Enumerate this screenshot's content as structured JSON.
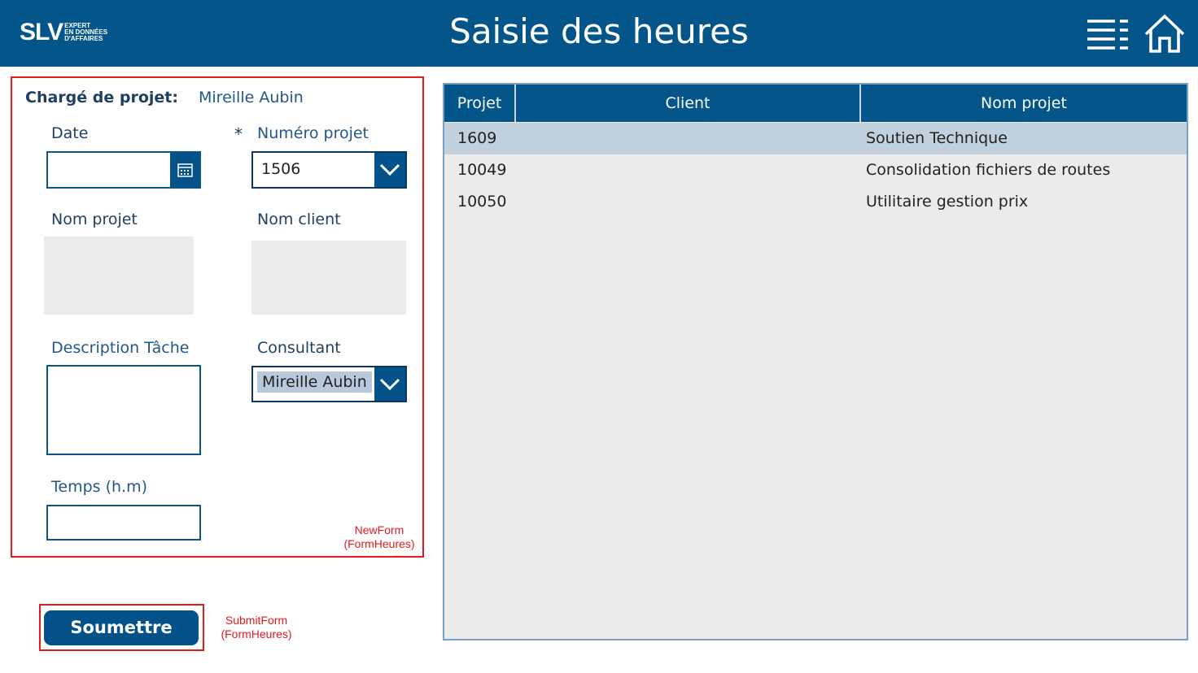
{
  "header": {
    "logo_main": "SLV",
    "logo_tag1": "EXPERT",
    "logo_tag2": "EN DONNÉES",
    "logo_tag3": "D'AFFAIRES",
    "title": "Saisie des heures",
    "menu_icon": "menu-list-icon",
    "home_icon": "home-icon"
  },
  "form": {
    "charge_label": "Chargé de projet:",
    "charge_value": "Mireille Aubin",
    "date_label": "Date",
    "date_value": "",
    "required_mark": "*",
    "numero_label": "Numéro projet",
    "numero_value": "1506",
    "nom_projet_label": "Nom projet",
    "nom_client_label": "Nom client",
    "description_label": "Description Tâche",
    "consultant_label": "Consultant",
    "consultant_value": "Mireille Aubin",
    "temps_label": "Temps (h.m)",
    "annotation_line1": "NewForm",
    "annotation_line2": "(FormHeures)"
  },
  "submit": {
    "label": "Soumettre",
    "annotation_line1": "SubmitForm",
    "annotation_line2": "(FormHeures)"
  },
  "table": {
    "headers": [
      "Projet",
      "Client",
      "Nom projet"
    ],
    "rows": [
      {
        "projet": "1609",
        "client": "",
        "nom_projet": "Soutien Technique"
      },
      {
        "projet": "10049",
        "client": "",
        "nom_projet": "Consolidation fichiers de routes"
      },
      {
        "projet": "10050",
        "client": "",
        "nom_projet": "Utilitaire gestion prix"
      }
    ]
  },
  "colors": {
    "brand_blue": "#03558a",
    "annotation_red": "#e41b1b",
    "selected_row": "#c0d0dd"
  }
}
